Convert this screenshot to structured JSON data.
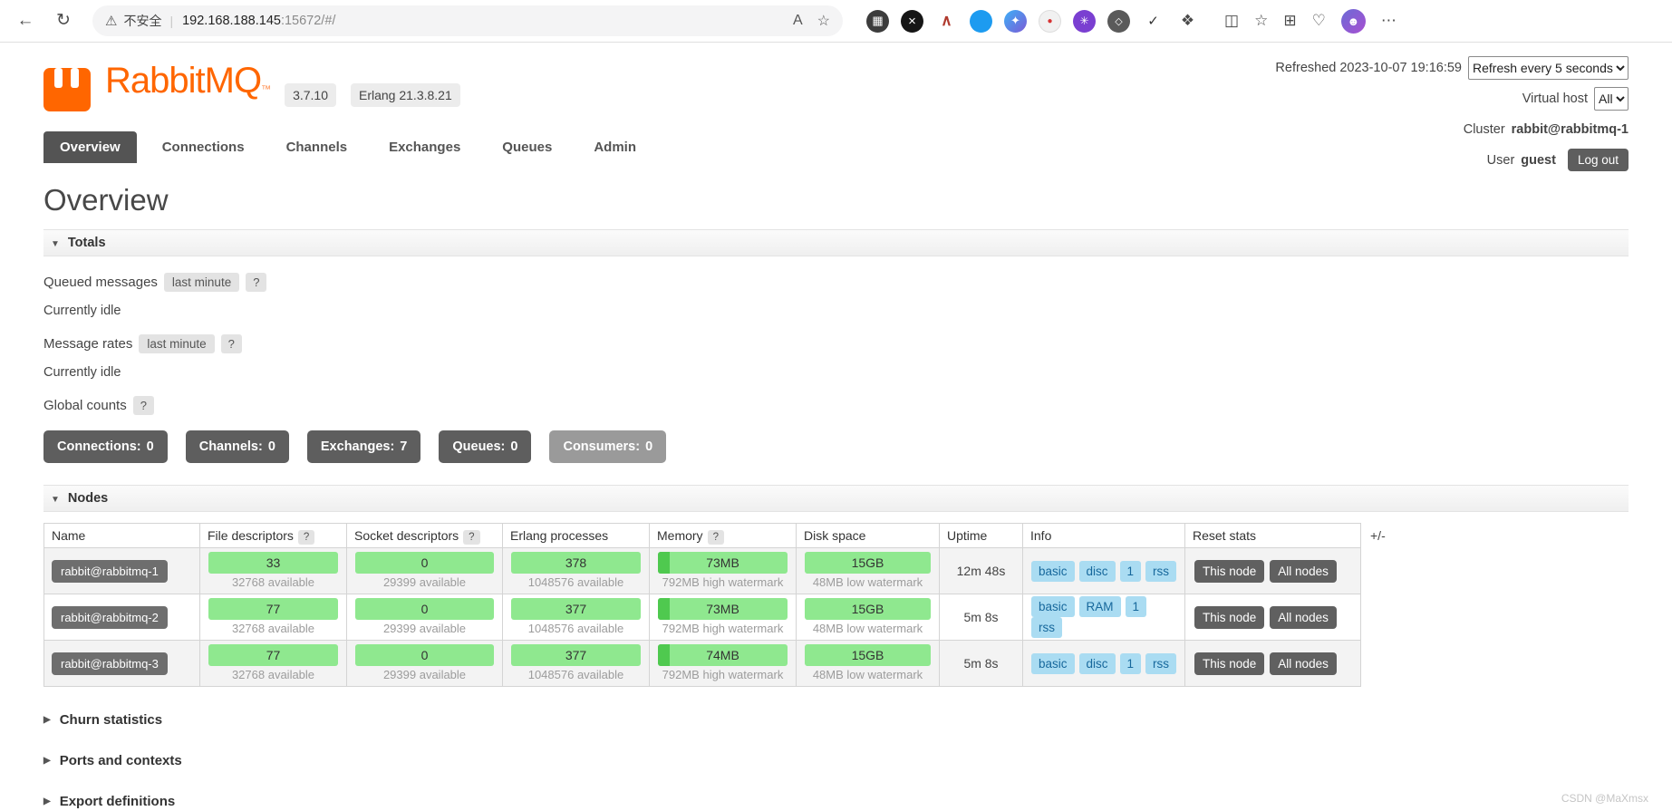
{
  "browser": {
    "back_icon": "←",
    "refresh_icon": "↻",
    "warning_icon": "⚠",
    "security_label": "不安全",
    "divider": "|",
    "url_host": "192.168.188.145",
    "url_path": ":15672/#/",
    "read_aloud_icon": "A",
    "favorite_star_icon": "☆",
    "extensions": [
      {
        "name": "grid-extension-icon",
        "glyph": "▦"
      },
      {
        "name": "close-extension-icon",
        "glyph": "×"
      },
      {
        "name": "caret-extension-icon",
        "glyph": "∧"
      },
      {
        "name": "bird-extension-icon",
        "glyph": ""
      },
      {
        "name": "kite-extension-icon",
        "glyph": "✦"
      },
      {
        "name": "record-extension-icon",
        "glyph": "●"
      },
      {
        "name": "flower-extension-icon",
        "glyph": "✳"
      },
      {
        "name": "pattern-extension-icon",
        "glyph": "◇"
      },
      {
        "name": "check-extension-icon",
        "glyph": "✓"
      },
      {
        "name": "puzzle-extension-icon",
        "glyph": "❖"
      }
    ],
    "split_screen_icon": "◫",
    "favorites_bar_icon": "☆",
    "collections_icon": "⊞",
    "essentials_icon": "♡",
    "avatar_glyph": "☻",
    "menu_icon": "⋯"
  },
  "header": {
    "brand": "RabbitMQ",
    "trademark": "™",
    "version_badge": "3.7.10",
    "erlang_badge": "Erlang 21.3.8.21",
    "refreshed_text": "Refreshed 2023-10-07 19:16:59",
    "refresh_interval_option": "Refresh every 5 seconds",
    "virtual_host_label": "Virtual host",
    "virtual_host_option": "All",
    "cluster_label": "Cluster",
    "cluster_name": "rabbit@rabbitmq-1",
    "user_label": "User",
    "user_name": "guest",
    "logout_label": "Log out"
  },
  "tabs": [
    {
      "label": "Overview"
    },
    {
      "label": "Connections"
    },
    {
      "label": "Channels"
    },
    {
      "label": "Exchanges"
    },
    {
      "label": "Queues"
    },
    {
      "label": "Admin"
    }
  ],
  "page": {
    "title": "Overview"
  },
  "ui": {
    "help": "?",
    "expanded_icon": "▼",
    "collapsed_icon": "▶"
  },
  "totals": {
    "title": "Totals",
    "queued_messages_label": "Queued messages",
    "queued_messages_window": "last minute",
    "queued_messages_status": "Currently idle",
    "message_rates_label": "Message rates",
    "message_rates_window": "last minute",
    "message_rates_status": "Currently idle",
    "global_counts_label": "Global counts",
    "counters": [
      {
        "label": "Connections:",
        "value": "0"
      },
      {
        "label": "Channels:",
        "value": "0"
      },
      {
        "label": "Exchanges:",
        "value": "7"
      },
      {
        "label": "Queues:",
        "value": "0"
      },
      {
        "label": "Consumers:",
        "value": "0"
      }
    ]
  },
  "nodes": {
    "title": "Nodes",
    "columns": [
      "Name",
      "File descriptors",
      "Socket descriptors",
      "Erlang processes",
      "Memory",
      "Disk space",
      "Uptime",
      "Info",
      "Reset stats"
    ],
    "column_picker": "+/-",
    "rows": [
      {
        "name": "rabbit@rabbitmq-1",
        "file_descriptors": "33",
        "file_descriptors_available": "32768 available",
        "socket_descriptors": "0",
        "socket_descriptors_available": "29399 available",
        "erlang_processes": "378",
        "erlang_processes_available": "1048576 available",
        "memory": "73MB",
        "memory_watermark": "792MB high watermark",
        "disk_space": "15GB",
        "disk_watermark": "48MB low watermark",
        "uptime": "12m 48s",
        "info": [
          "basic",
          "disc",
          "1",
          "rss"
        ],
        "reset_this": "This node",
        "reset_all": "All nodes"
      },
      {
        "name": "rabbit@rabbitmq-2",
        "file_descriptors": "77",
        "file_descriptors_available": "32768 available",
        "socket_descriptors": "0",
        "socket_descriptors_available": "29399 available",
        "erlang_processes": "377",
        "erlang_processes_available": "1048576 available",
        "memory": "73MB",
        "memory_watermark": "792MB high watermark",
        "disk_space": "15GB",
        "disk_watermark": "48MB low watermark",
        "uptime": "5m 8s",
        "info": [
          "basic",
          "RAM",
          "1",
          "rss"
        ],
        "reset_this": "This node",
        "reset_all": "All nodes"
      },
      {
        "name": "rabbit@rabbitmq-3",
        "file_descriptors": "77",
        "file_descriptors_available": "32768 available",
        "socket_descriptors": "0",
        "socket_descriptors_available": "29399 available",
        "erlang_processes": "377",
        "erlang_processes_available": "1048576 available",
        "memory": "74MB",
        "memory_watermark": "792MB high watermark",
        "disk_space": "15GB",
        "disk_watermark": "48MB low watermark",
        "uptime": "5m 8s",
        "info": [
          "basic",
          "disc",
          "1",
          "rss"
        ],
        "reset_this": "This node",
        "reset_all": "All nodes"
      }
    ]
  },
  "sections": [
    {
      "title": "Churn statistics"
    },
    {
      "title": "Ports and contexts"
    },
    {
      "title": "Export definitions"
    }
  ],
  "watermark": "CSDN @MaXmsx",
  "colors": {
    "accent": "#ff6600",
    "bar_green": "#8fe88f",
    "bar_green_dark": "#4fc94f",
    "badge_blue": "#aadcf2",
    "button_dark": "#5e5e5e",
    "button_muted": "#9a9a9a"
  }
}
